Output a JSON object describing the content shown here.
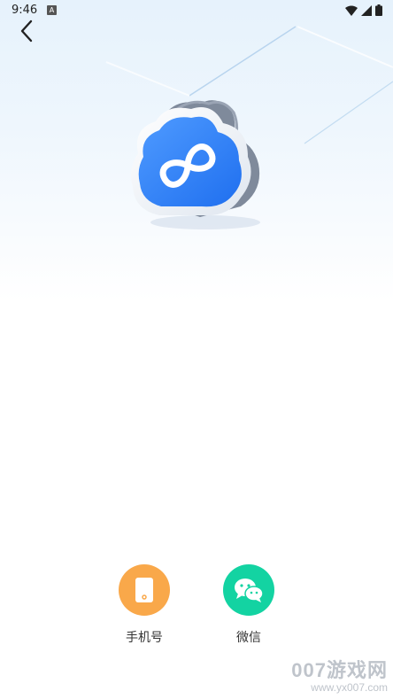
{
  "status_bar": {
    "time": "9:46",
    "notification_icon": "A",
    "icons": [
      "wifi-icon",
      "signal-icon",
      "battery-icon"
    ]
  },
  "header": {
    "back_icon": "chevron-left-icon"
  },
  "illustration": {
    "icon": "cloud-infinity-icon",
    "colors": {
      "cloud_blue": "#2f7df6",
      "cloud_rim": "#f4f7fb",
      "cloud_shadow": "#8a93a3"
    }
  },
  "login_options": [
    {
      "label": "手机号",
      "icon": "phone-icon",
      "color": "#f9a84a"
    },
    {
      "label": "微信",
      "icon": "wechat-icon",
      "color": "#13d3a2"
    }
  ],
  "watermark": {
    "brand": "007游戏网",
    "url": "www.yx007.com"
  }
}
